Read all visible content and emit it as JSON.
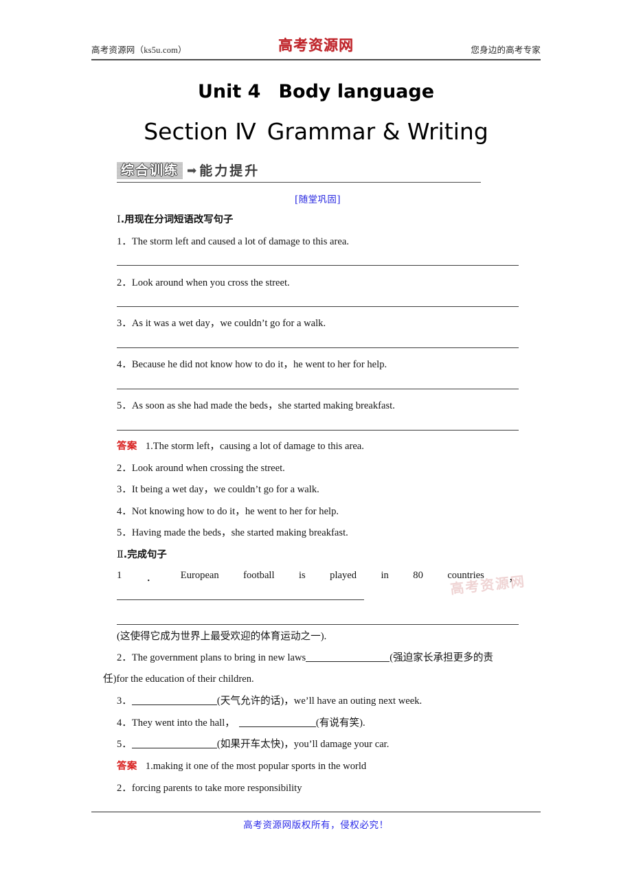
{
  "header": {
    "left": "高考资源网（ks5u.com）",
    "logo": "高考资源网",
    "right": "您身边的高考专家"
  },
  "titles": {
    "unit": "Unit 4",
    "unit_name": "Body language",
    "section": "Section Ⅳ",
    "section_name": "Grammar & Writing"
  },
  "banner": {
    "box_label": "综合训练",
    "arrow": "➡",
    "sub_label": "能力提升",
    "sub_title": "[随堂巩固]"
  },
  "part1": {
    "heading_numeral": "Ⅰ",
    "heading_text": ".用现在分词短语改写句子",
    "questions": [
      "1．The storm left and caused a lot of damage to this area.",
      "2．Look around when you cross the street.",
      "3．As it was a wet day，we couldn’t go for a walk.",
      "4．Because he did not know how to do it，he went to her for help.",
      "5．As soon as she had made the beds，she started making breakfast."
    ],
    "answer_tag": "答案",
    "answers": [
      "1.The storm left，causing a lot of damage to this area.",
      "2．Look around when crossing the street.",
      "3．It being a wet day，we couldn’t go for a walk.",
      "4．Not knowing how to do it，he went to her for help.",
      "5．Having made the beds，she started making breakfast."
    ]
  },
  "part2": {
    "heading_numeral": "Ⅱ",
    "heading_text": ".完成句子",
    "q1_words": [
      "1",
      "．",
      "European",
      "football",
      "is",
      "played",
      "in",
      "80",
      "countries",
      "，"
    ],
    "q1_hint": "(这使得它成为世界上最受欢迎的体育运动之一).",
    "q2_a": "2．The government plans to bring in new laws",
    "q2_b": "(强迫家长承担更多的责",
    "q2_c": "任)for the education of their children.",
    "q3_a": "3．",
    "q3_b": "(天气允许的话)，we’ll have an outing next week.",
    "q4_a": "4．They went into the hall，",
    "q4_b": "(有说有笑).",
    "q5_a": "5．",
    "q5_b": "(如果开车太快)，you’ll damage your car.",
    "answer_tag": "答案",
    "answers": [
      "1.making it one of the most popular sports in the world",
      "2．forcing parents to take more responsibility"
    ]
  },
  "watermark": "高考资源网",
  "footer": {
    "text": "高考资源网版权所有，侵权必究！"
  },
  "colors": {
    "logo_red": "#c0242a",
    "answer_red": "#d8201f",
    "link_blue": "#2727e0",
    "footer_blue": "#2a2ae8",
    "rule_gray": "#4a4a4a"
  }
}
